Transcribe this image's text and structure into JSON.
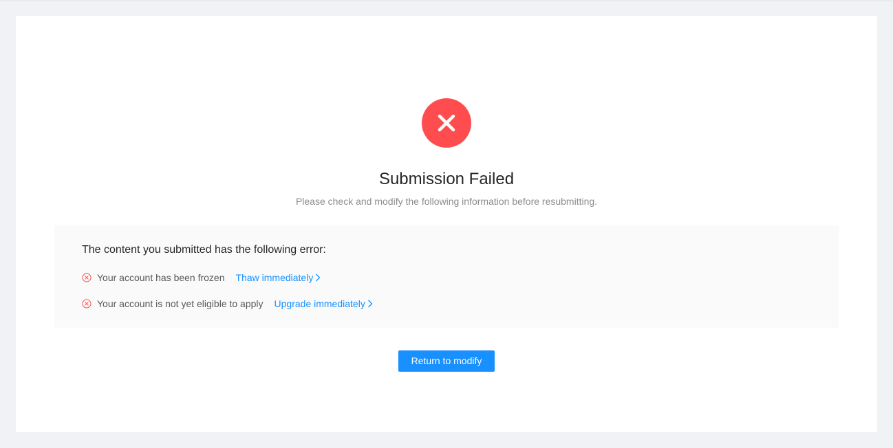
{
  "colors": {
    "page_bg": "#f0f2f5",
    "card_bg": "#ffffff",
    "error_red": "#ff4d4f",
    "link_blue": "#1890ff",
    "primary_blue": "#1890ff",
    "error_box_bg": "#fafafa"
  },
  "result": {
    "icon": "close-circle-icon",
    "title": "Submission Failed",
    "subtitle": "Please check and modify the following information before resubmitting."
  },
  "errors": {
    "heading": "The content you submitted has the following error:",
    "items": [
      {
        "icon": "close-circle-outline-icon",
        "text": "Your account has been frozen",
        "link_label": "Thaw immediately",
        "link_icon": "chevron-right-icon"
      },
      {
        "icon": "close-circle-outline-icon",
        "text": "Your account is not yet eligible to apply",
        "link_label": "Upgrade immediately",
        "link_icon": "chevron-right-icon"
      }
    ]
  },
  "actions": {
    "primary_label": "Return to modify"
  }
}
